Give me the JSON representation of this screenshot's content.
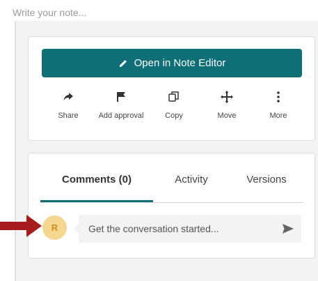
{
  "note": {
    "placeholder": "Write your note..."
  },
  "actions_card": {
    "open_button_label": "Open in Note Editor",
    "actions": [
      {
        "label": "Share",
        "icon": "share-icon"
      },
      {
        "label": "Add approval",
        "icon": "flag-icon"
      },
      {
        "label": "Copy",
        "icon": "copy-icon"
      },
      {
        "label": "Move",
        "icon": "move-icon"
      },
      {
        "label": "More",
        "icon": "more-vertical-icon"
      }
    ]
  },
  "comments_card": {
    "tabs": [
      {
        "label": "Comments (0)",
        "active": true
      },
      {
        "label": "Activity",
        "active": false
      },
      {
        "label": "Versions",
        "active": false
      }
    ],
    "avatar_initial": "R",
    "comment_placeholder": "Get the conversation started..."
  },
  "colors": {
    "accent": "#0e6f76",
    "avatar_bg": "#f6d78f",
    "avatar_text": "#d38b1b",
    "annotation_arrow": "#a61b1b"
  }
}
